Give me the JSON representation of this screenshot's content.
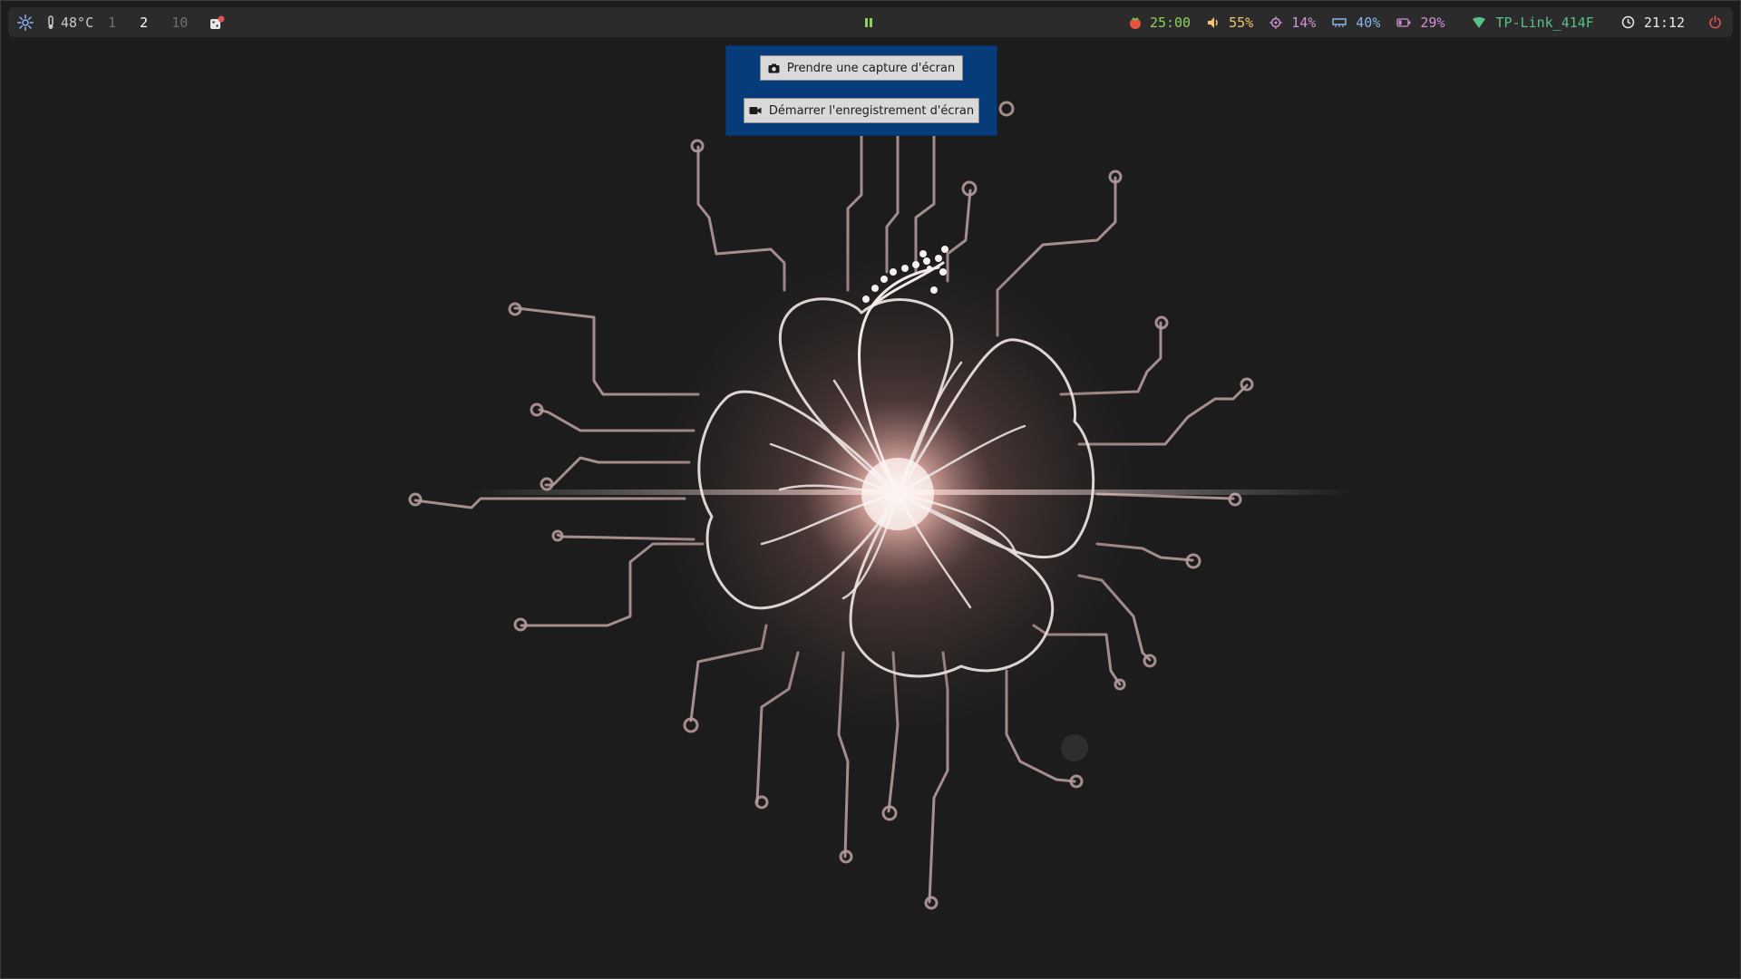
{
  "colors": {
    "desktop_bg": "#1c1c1c",
    "bar_bg": "#2b2b2b",
    "popup_bg": "#063c79",
    "accent_green": "#8fcf5a",
    "accent_pink": "#d291d2",
    "power_red": "#e05353"
  },
  "bar": {
    "left": {
      "logo_icon": "gear-flower-icon",
      "temperature": "48°C",
      "workspaces": [
        "1",
        "2",
        "10"
      ],
      "active_workspace": "2",
      "app_icon": "dice-icon"
    },
    "center": {
      "media_status_icon": "pause-icon"
    },
    "right": {
      "pomodoro": "25:00",
      "volume": "55%",
      "cpu": "14%",
      "memory": "40%",
      "battery": "29%",
      "wifi": "TP-Link_414F",
      "clock": "21:12",
      "power_icon": "power-icon"
    }
  },
  "popup": {
    "screenshot_label": "Prendre une capture d'écran",
    "record_label": "Démarrer l'enregistrement d'écran"
  },
  "wallpaper": {
    "description_icon": "hibiscus-circuit-wallpaper"
  }
}
